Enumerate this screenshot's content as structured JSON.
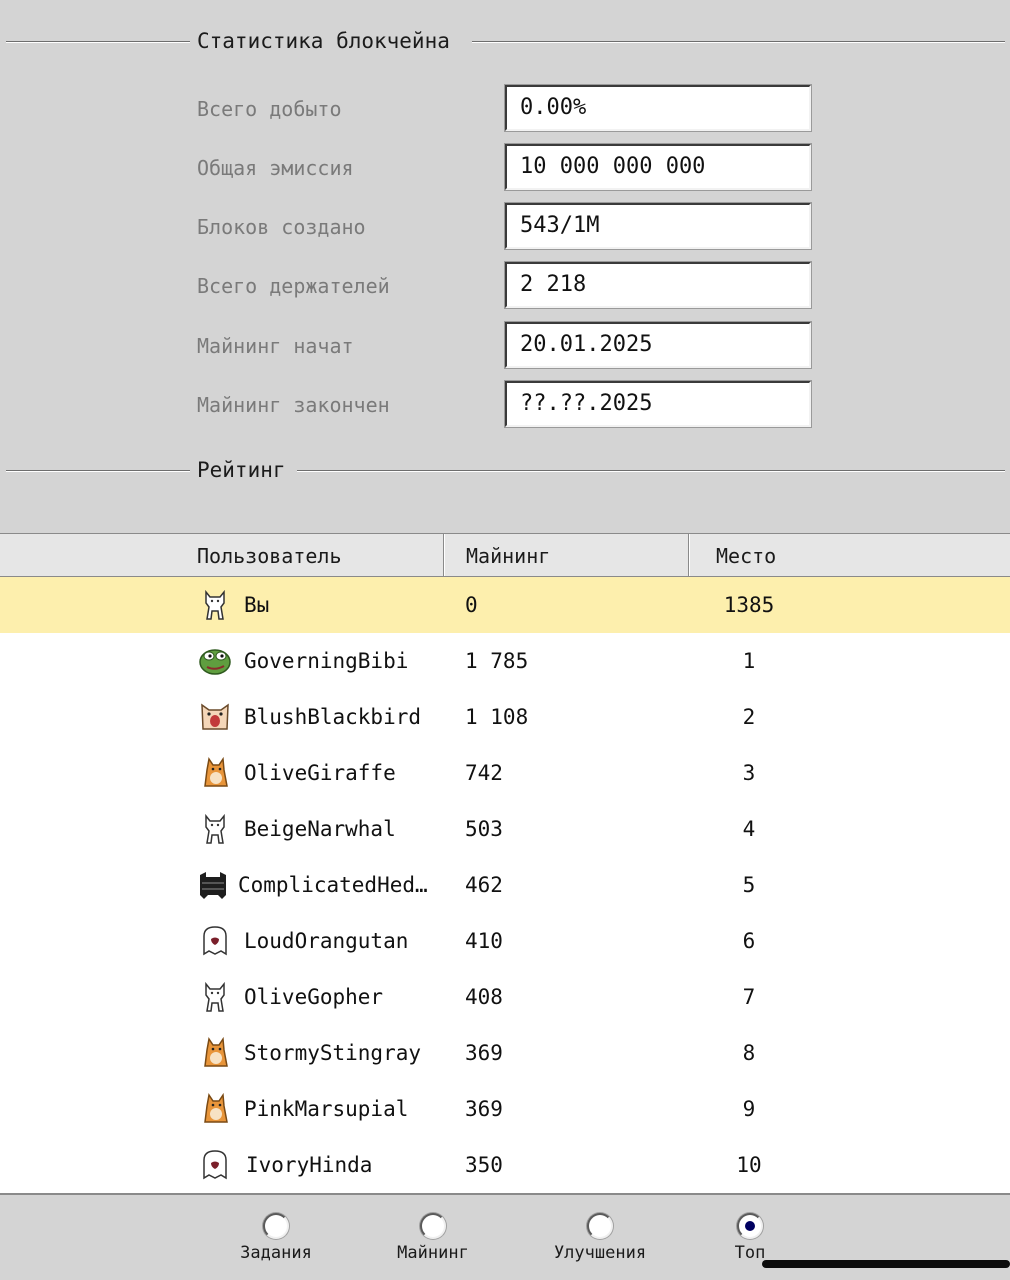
{
  "stats": {
    "title": "Статистика блокчейна",
    "rows": [
      {
        "label": "Всего добыто",
        "value": "0.00%"
      },
      {
        "label": "Общая эмиссия",
        "value": "10 000 000 000"
      },
      {
        "label": "Блоков создано",
        "value": "543/1M"
      },
      {
        "label": "Всего держателей",
        "value": "2 218"
      },
      {
        "label": "Майнинг начат",
        "value": "20.01.2025"
      },
      {
        "label": "Майнинг закончен",
        "value": "??.??.2025"
      }
    ]
  },
  "rating": {
    "title": "Рейтинг",
    "columns": {
      "user": "Пользователь",
      "mining": "Майнинг",
      "place": "Место"
    },
    "rows": [
      {
        "avatar": "cat-icon",
        "name": "Вы",
        "mining": "0",
        "place": "1385",
        "highlight": true
      },
      {
        "avatar": "frog-icon",
        "name": "GoverningBibi",
        "mining": "1 785",
        "place": "1"
      },
      {
        "avatar": "screaming-cat-icon",
        "name": "BlushBlackbird",
        "mining": "1 108",
        "place": "2"
      },
      {
        "avatar": "shiba-icon",
        "name": "OliveGiraffe",
        "mining": "742",
        "place": "3"
      },
      {
        "avatar": "cat-icon",
        "name": "BeigeNarwhal",
        "mining": "503",
        "place": "4"
      },
      {
        "avatar": "black-cat-icon",
        "name": "ComplicatedHed…",
        "mining": "462",
        "place": "5"
      },
      {
        "avatar": "ghost-icon",
        "name": "LoudOrangutan",
        "mining": "410",
        "place": "6"
      },
      {
        "avatar": "cat-icon",
        "name": "OliveGopher",
        "mining": "408",
        "place": "7"
      },
      {
        "avatar": "shiba-icon",
        "name": "StormyStingray",
        "mining": "369",
        "place": "8"
      },
      {
        "avatar": "shiba-icon",
        "name": "PinkMarsupial",
        "mining": "369",
        "place": "9"
      },
      {
        "avatar": "ghost-icon",
        "name": "IvoryHinda",
        "mining": "350",
        "place": "10"
      }
    ]
  },
  "nav": {
    "items": [
      {
        "label": "Задания",
        "selected": false
      },
      {
        "label": "Майнинг",
        "selected": false
      },
      {
        "label": "Улучшения",
        "selected": false
      },
      {
        "label": "Топ",
        "selected": true
      }
    ]
  },
  "colors": {
    "background": "#d4d4d4",
    "highlight_row": "#fdefad",
    "radio_dot": "#000060"
  }
}
